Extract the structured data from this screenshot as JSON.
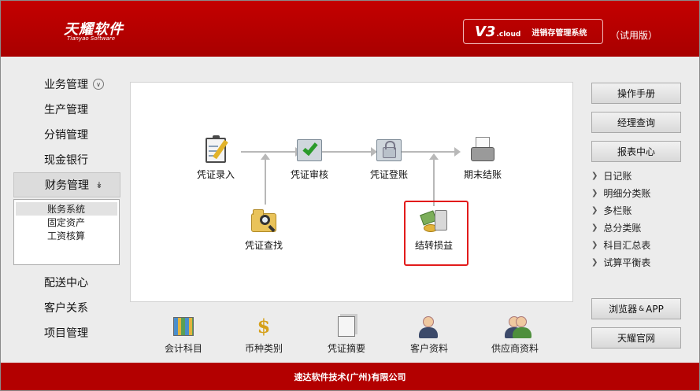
{
  "header": {
    "logo_cn": "天耀软件",
    "logo_en": "Tianyao Software",
    "version_main": "V3",
    "version_suffix": ".cloud",
    "system_name": "进销存管理系统",
    "edition": "（试用版）"
  },
  "left_nav": {
    "items_top": [
      "业务管理",
      "生产管理",
      "分销管理",
      "现金银行"
    ],
    "active": "财务管理",
    "submenu": [
      "账务系统",
      "固定资产",
      "工资核算"
    ],
    "items_bottom": [
      "配送中心",
      "客户关系",
      "项目管理"
    ]
  },
  "flow": {
    "voucher_entry": "凭证录入",
    "voucher_review": "凭证审核",
    "voucher_post": "凭证登账",
    "period_close": "期末结账",
    "voucher_search": "凭证查找",
    "transfer_pl": "结转损益"
  },
  "shortcuts": [
    "会计科目",
    "币种类别",
    "凭证摘要",
    "客户资料",
    "供应商资料"
  ],
  "right_panel": {
    "manual": "操作手册",
    "manager_query": "经理查询",
    "report_center": "报表中心",
    "reports": [
      "日记账",
      "明细分类账",
      "多栏账",
      "总分类账",
      "科目汇总表",
      "试算平衡表"
    ],
    "browser": "浏览器",
    "amp": "&",
    "app": "APP",
    "official_site": "天耀官网"
  },
  "footer": {
    "company": "速达软件技术(广州)有限公司"
  },
  "colors": {
    "brand_red": "#b30000",
    "highlight_red": "#e21b1b"
  }
}
